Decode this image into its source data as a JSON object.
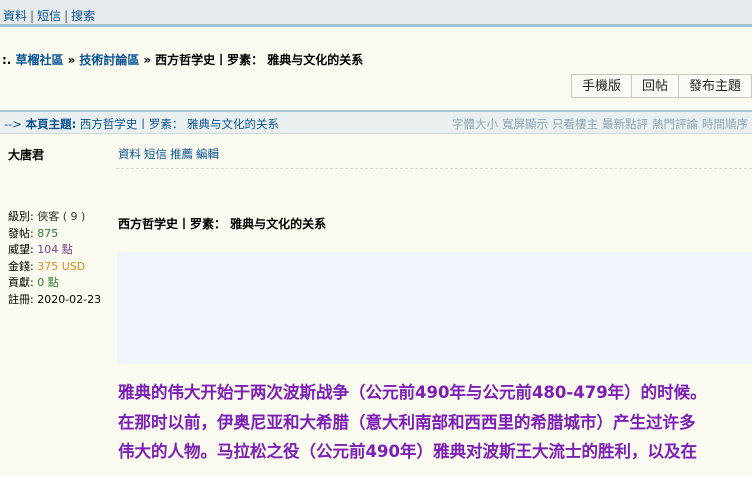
{
  "topbar": {
    "profile": "資料",
    "messages": "短信",
    "search": "搜索",
    "sep": "|"
  },
  "breadcrumb": {
    "prefix": ":.",
    "items": [
      "草榴社區",
      "技術討論區"
    ],
    "arrow": "»",
    "current": "西方哲学史丨罗素： 雅典与文化的关系"
  },
  "actions": {
    "mobile": "手機版",
    "reply": "回帖",
    "new_topic": "發布主題"
  },
  "topic_bar": {
    "arrow": "-->",
    "label": "本頁主題:",
    "title": "西方哲学史丨罗素： 雅典与文化的关系",
    "options": [
      "字體大小",
      "寬屏顯示",
      "只看樓主",
      "最新點評",
      "熱門評論",
      "時間順序"
    ]
  },
  "post": {
    "author": "大唐君",
    "tools": [
      "資料",
      "短信",
      "推薦",
      "編輯"
    ],
    "user": {
      "level_label": "級別:",
      "level_value": "俠客 ( 9 )",
      "posts_label": "發帖:",
      "posts_value": "875",
      "prestige_label": "威望:",
      "prestige_value": "104 點",
      "money_label": "金錢:",
      "money_value": "375 USD",
      "contrib_label": "貢獻:",
      "contrib_value": "0 點",
      "reg_label": "註冊:",
      "reg_value": "2020-02-23"
    },
    "title": "西方哲学史丨罗素： 雅典与文化的关系",
    "body_lines": [
      "雅典的伟大开始于两次波斯战争（公元前490年与公元前480-479年）的时候。",
      "在那时以前，伊奥尼亚和大希腊（意大利南部和西西里的希腊城市）产生过许多",
      "伟大的人物。马拉松之役（公元前490年）雅典对波斯王大流士的胜利，以及在"
    ]
  }
}
